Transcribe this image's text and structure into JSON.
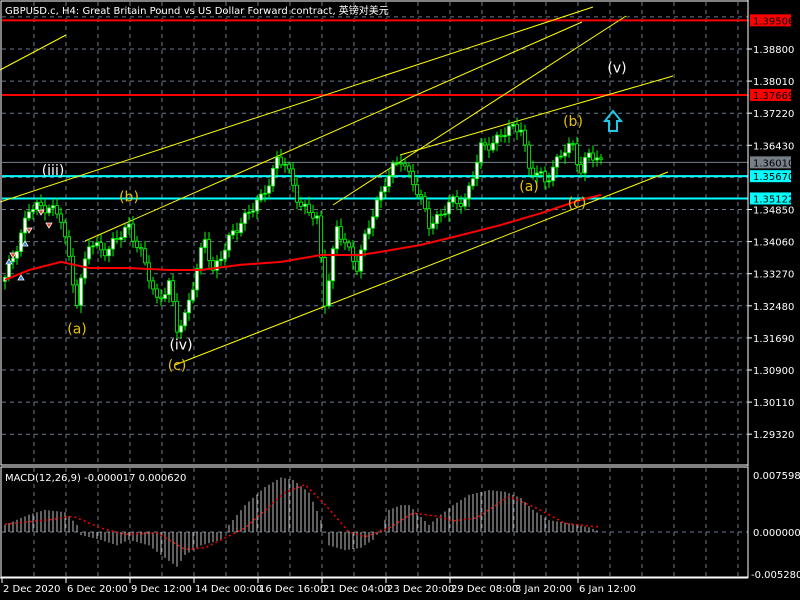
{
  "header": {
    "title": "GBPUSD.c, H4:  Great Britain Pound vs US Dollar Forward contract, 英镑对美元"
  },
  "macd": {
    "title": "MACD(12,26,9) -0.000017 0.000620",
    "axis_labels": [
      "0.007598",
      "0.000000",
      "-0.005280"
    ]
  },
  "colors": {
    "background": "#000000",
    "candle": "#00ff00",
    "bull_body": "#ffffff",
    "ma": "#ff0000",
    "trendline": "#ffff00",
    "level_red": "#ff0000",
    "level_cyan": "#00ffff",
    "grid": "#6c7a89",
    "histogram": "#c0c0c0",
    "signal": "#ff0000",
    "wave_yellow": "#e6c200",
    "wave_white": "#ffffff"
  },
  "chart_data": {
    "type": "candlestick",
    "symbol": "GBPUSD.c",
    "timeframe": "H4",
    "ylim": [
      1.2857,
      1.3999
    ],
    "price_ticks": [
      "1.38800",
      "1.38010",
      "1.37220",
      "1.36430",
      "1.34850",
      "1.34060",
      "1.33270",
      "1.32480",
      "1.31690",
      "1.30900",
      "1.30110",
      "1.29320"
    ],
    "time_ticks": [
      "2 Dec 2020",
      "6 Dec 20:00",
      "9 Dec 12:00",
      "14 Dec 00:00",
      "16 Dec 16:00",
      "21 Dec 04:00",
      "23 Dec 20:00",
      "29 Dec 08:00",
      "3 Jan 20:00",
      "6 Jan 12:00"
    ],
    "candle_count": 150,
    "close_path": [
      [
        0,
        1.3312
      ],
      [
        6,
        1.3484
      ],
      [
        11,
        1.3496
      ],
      [
        14,
        1.3459
      ],
      [
        18,
        1.3263
      ],
      [
        21,
        1.3398
      ],
      [
        26,
        1.3386
      ],
      [
        31,
        1.3447
      ],
      [
        34,
        1.3373
      ],
      [
        38,
        1.3263
      ],
      [
        41,
        1.3299
      ],
      [
        43,
        1.3189
      ],
      [
        45,
        1.3226
      ],
      [
        50,
        1.341
      ],
      [
        52,
        1.3336
      ],
      [
        59,
        1.3459
      ],
      [
        64,
        1.3509
      ],
      [
        68,
        1.3607
      ],
      [
        70,
        1.3595
      ],
      [
        74,
        1.3496
      ],
      [
        78,
        1.3459
      ],
      [
        80,
        1.3263
      ],
      [
        83,
        1.3435
      ],
      [
        88,
        1.3349
      ],
      [
        92,
        1.3472
      ],
      [
        95,
        1.3558
      ],
      [
        99,
        1.3607
      ],
      [
        102,
        1.3558
      ],
      [
        106,
        1.3447
      ],
      [
        111,
        1.3496
      ],
      [
        115,
        1.3509
      ],
      [
        119,
        1.3632
      ],
      [
        124,
        1.3668
      ],
      [
        129,
        1.3693
      ],
      [
        131,
        1.3582
      ],
      [
        135,
        1.3558
      ],
      [
        139,
        1.3619
      ],
      [
        142,
        1.3644
      ],
      [
        144,
        1.3582
      ],
      [
        146,
        1.3619
      ],
      [
        149,
        1.3601
      ]
    ],
    "moving_average": [
      [
        0,
        1.3312
      ],
      [
        6,
        1.3336
      ],
      [
        14,
        1.3356
      ],
      [
        21,
        1.3341
      ],
      [
        31,
        1.3341
      ],
      [
        41,
        1.3336
      ],
      [
        49,
        1.3336
      ],
      [
        59,
        1.3349
      ],
      [
        69,
        1.3356
      ],
      [
        79,
        1.3373
      ],
      [
        89,
        1.3373
      ],
      [
        94,
        1.3381
      ],
      [
        104,
        1.3398
      ],
      [
        114,
        1.3422
      ],
      [
        124,
        1.3447
      ],
      [
        134,
        1.3476
      ],
      [
        144,
        1.3509
      ],
      [
        149,
        1.3521
      ]
    ],
    "levels": [
      {
        "label": "1.39506",
        "price": 1.39506,
        "color": "#ff0000",
        "text_color": "#000000"
      },
      {
        "label": "1.37669",
        "price": 1.37669,
        "color": "#ff0000",
        "text_color": "#000000"
      },
      {
        "label": "1.36010",
        "price": 1.3601,
        "color": "#778088",
        "text_color": "#000000"
      },
      {
        "label": "1.35670",
        "price": 1.3567,
        "color": "#00ffff",
        "text_color": "#000000"
      },
      {
        "label": "1.35122",
        "price": 1.35122,
        "color": "#00ffff",
        "text_color": "#000000"
      }
    ],
    "wave_labels": [
      {
        "text": "(iii)",
        "i": 12,
        "price": 1.357,
        "color": "#ffffff"
      },
      {
        "text": "(b)",
        "i": 31,
        "price": 1.3505,
        "color": "#e6c200"
      },
      {
        "text": "(a)",
        "i": 18,
        "price": 1.318,
        "color": "#e6c200"
      },
      {
        "text": "(iv)",
        "i": 44,
        "price": 1.314,
        "color": "#ffffff"
      },
      {
        "text": "(c)",
        "i": 43,
        "price": 1.309,
        "color": "#e6c200"
      },
      {
        "text": "(a)",
        "i": 131,
        "price": 1.353,
        "color": "#e6c200"
      },
      {
        "text": "(b)",
        "i": 142,
        "price": 1.369,
        "color": "#e6c200"
      },
      {
        "text": "(c)",
        "i": 143,
        "price": 1.349,
        "color": "#e6c200"
      },
      {
        "text": "(v)",
        "i": 153,
        "price": 1.3822,
        "color": "#ffffff"
      }
    ],
    "macd_histogram": [
      [
        0,
        0.0009
      ],
      [
        6,
        0.0022
      ],
      [
        10,
        0.0028
      ],
      [
        15,
        0.0025
      ],
      [
        18,
        0.0009
      ],
      [
        19,
        -0.0004
      ],
      [
        24,
        -0.001
      ],
      [
        28,
        -0.0017
      ],
      [
        31,
        -0.001
      ],
      [
        36,
        -0.0017
      ],
      [
        39,
        -0.0029
      ],
      [
        43,
        -0.0044
      ],
      [
        45,
        -0.0029
      ],
      [
        49,
        -0.0017
      ],
      [
        54,
        -0.001
      ],
      [
        56,
        0.0009
      ],
      [
        60,
        0.0034
      ],
      [
        65,
        0.0057
      ],
      [
        69,
        0.0069
      ],
      [
        72,
        0.0066
      ],
      [
        76,
        0.005
      ],
      [
        79,
        0.0015
      ],
      [
        81,
        -0.0017
      ],
      [
        85,
        -0.0023
      ],
      [
        89,
        -0.002
      ],
      [
        92,
        -0.001
      ],
      [
        94,
        0.0003
      ],
      [
        96,
        0.0028
      ],
      [
        99,
        0.0034
      ],
      [
        101,
        0.0034
      ],
      [
        104,
        0.0019
      ],
      [
        106,
        0.0009
      ],
      [
        109,
        0.0022
      ],
      [
        112,
        0.0034
      ],
      [
        116,
        0.0047
      ],
      [
        121,
        0.0053
      ],
      [
        125,
        0.0051
      ],
      [
        129,
        0.0043
      ],
      [
        132,
        0.0028
      ],
      [
        136,
        0.0015
      ],
      [
        141,
        0.0011
      ],
      [
        146,
        0.0006
      ],
      [
        149,
        -2e-05
      ]
    ],
    "macd_signal": [
      [
        0,
        0.001
      ],
      [
        12,
        0.0016
      ],
      [
        17,
        0.002
      ],
      [
        24,
        0.0005
      ],
      [
        30,
        -0.0003
      ],
      [
        38,
        -0.0001
      ],
      [
        45,
        -0.0022
      ],
      [
        50,
        -0.002
      ],
      [
        60,
        0.0005
      ],
      [
        70,
        0.005
      ],
      [
        75,
        0.006
      ],
      [
        80,
        0.0035
      ],
      [
        86,
        0.0
      ],
      [
        90,
        -0.0006
      ],
      [
        96,
        0.0005
      ],
      [
        102,
        0.0024
      ],
      [
        108,
        0.002
      ],
      [
        112,
        0.0014
      ],
      [
        118,
        0.0018
      ],
      [
        126,
        0.0045
      ],
      [
        133,
        0.003
      ],
      [
        140,
        0.0011
      ],
      [
        149,
        0.0006
      ]
    ],
    "macd_ylim": [
      -0.00528,
      0.007598
    ]
  }
}
